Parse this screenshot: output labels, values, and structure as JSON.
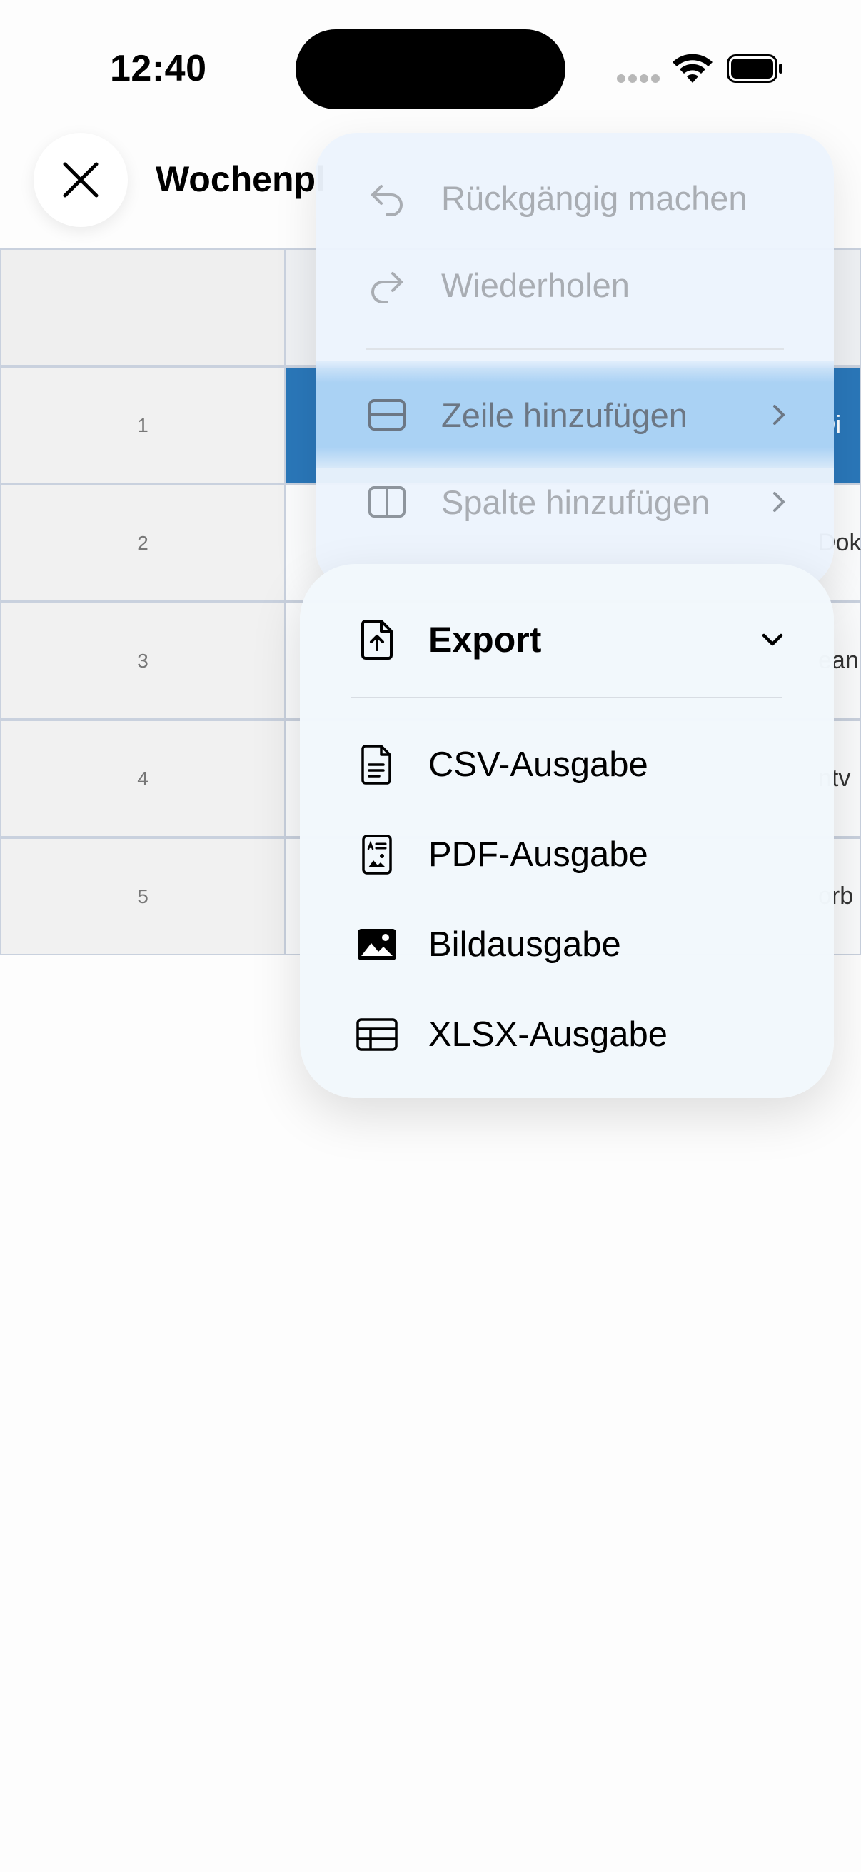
{
  "status_bar": {
    "time": "12:40"
  },
  "header": {
    "title": "Wochenpl"
  },
  "table": {
    "rows": [
      {
        "num": "",
        "peek": ""
      },
      {
        "num": "1",
        "peek": "Di",
        "selected": true
      },
      {
        "num": "2",
        "peek": "Dok"
      },
      {
        "num": "3",
        "peek": "ean"
      },
      {
        "num": "4",
        "peek": "ntv"
      },
      {
        "num": "5",
        "peek": "orb"
      }
    ]
  },
  "menu": {
    "undo": "Rückgängig machen",
    "redo": "Wiederholen",
    "add_row": "Zeile hinzufügen",
    "add_column": "Spalte hinzufügen"
  },
  "export": {
    "title": "Export",
    "items": [
      {
        "label": "CSV-Ausgabe",
        "icon": "csv-file-icon"
      },
      {
        "label": "PDF-Ausgabe",
        "icon": "pdf-file-icon"
      },
      {
        "label": "Bildausgabe",
        "icon": "image-icon"
      },
      {
        "label": "XLSX-Ausgabe",
        "icon": "table-icon"
      }
    ]
  },
  "colors": {
    "selected_cell": "#2a77b9",
    "highlight": "#a7d0f4",
    "menu_bg": "#ecf4fd",
    "disabled_text": "#a9adb3"
  }
}
